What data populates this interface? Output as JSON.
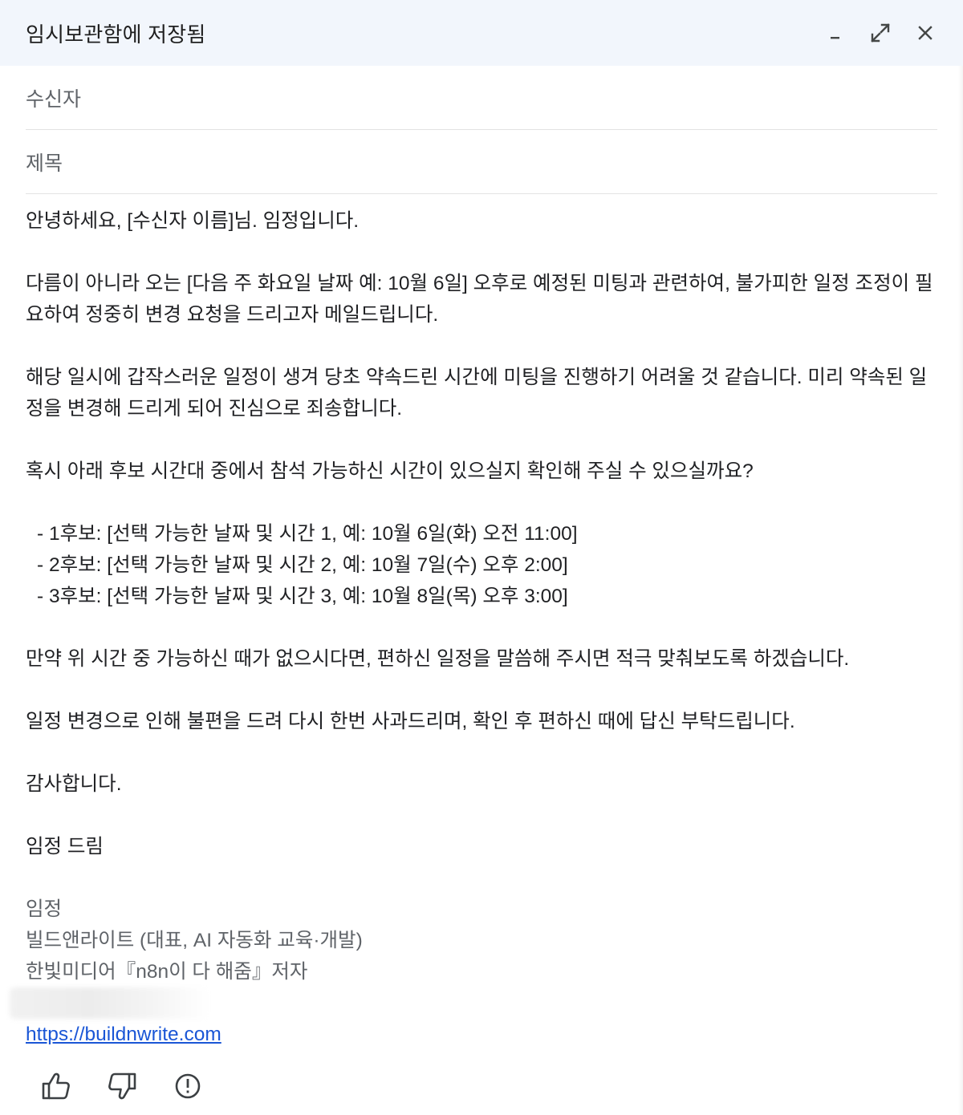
{
  "window": {
    "title": "임시보관함에 저장됨",
    "controls": {
      "minimize_icon": "minimize-icon",
      "expand_icon": "expand-icon",
      "close_icon": "close-icon"
    }
  },
  "fields": {
    "to_label": "수신자",
    "subject_label": "제목"
  },
  "body": {
    "greeting": "안녕하세요, [수신자 이름]님. 임정입니다.",
    "para1": "다름이 아니라 오는 [다음 주 화요일 날짜 예: 10월 6일] 오후로 예정된 미팅과 관련하여, 불가피한 일정 조정이 필요하여 정중히 변경 요청을 드리고자 메일드립니다.",
    "para2": "해당 일시에 갑작스러운 일정이 생겨 당초 약속드린 시간에 미팅을 진행하기 어려울 것 같습니다. 미리 약속된 일정을 변경해 드리게 되어 진심으로 죄송합니다.",
    "para3": "혹시 아래 후보 시간대 중에서 참석 가능하신 시간이 있으실지 확인해 주실 수 있으실까요?",
    "options": [
      "- 1후보: [선택 가능한 날짜 및 시간 1, 예: 10월 6일(화) 오전 11:00]",
      "- 2후보: [선택 가능한 날짜 및 시간 2, 예: 10월 7일(수) 오후 2:00]",
      "- 3후보: [선택 가능한 날짜 및 시간 3, 예: 10월 8일(목) 오후 3:00]"
    ],
    "para4": "만약 위 시간 중 가능하신 때가 없으시다면, 편하신 일정을 말씀해 주시면 적극 맞춰보도록 하겠습니다.",
    "para5": "일정 변경으로 인해 불편을 드려 다시 한번 사과드리며, 확인 후 편하신 때에 답신 부탁드립니다.",
    "thanks": "감사합니다.",
    "closing": "임정 드림"
  },
  "signature": {
    "name": "임정",
    "company": "빌드앤라이트 (대표, AI 자동화 교육·개발)",
    "book": "한빛미디어『n8n이 다 해줌』저자",
    "link": "https://buildnwrite.com"
  },
  "feedback": {
    "thumbs_up_icon": "thumbs-up-icon",
    "thumbs_down_icon": "thumbs-down-icon",
    "report_icon": "report-icon"
  }
}
